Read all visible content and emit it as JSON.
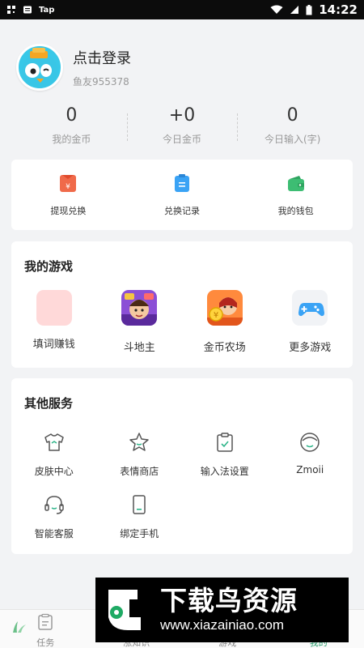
{
  "status_bar": {
    "app_label": "Tap",
    "time": "14:22"
  },
  "profile": {
    "login_text": "点击登录",
    "user_id": "鱼友955378"
  },
  "stats": [
    {
      "value": "0",
      "label": "我的金币"
    },
    {
      "value": "+0",
      "label": "今日金币"
    },
    {
      "value": "0",
      "label": "今日输入(字)"
    }
  ],
  "wallet": [
    {
      "label": "提现兑换",
      "icon": "withdraw-icon",
      "color": "#f06a4a"
    },
    {
      "label": "兑换记录",
      "icon": "record-icon",
      "color": "#3aa3f5"
    },
    {
      "label": "我的钱包",
      "icon": "wallet-icon",
      "color": "#3dbd73"
    }
  ],
  "games": {
    "title": "我的游戏",
    "items": [
      {
        "label": "填词赚钱",
        "icon": "fill-words-icon"
      },
      {
        "label": "斗地主",
        "icon": "doudizhu-icon"
      },
      {
        "label": "金币农场",
        "icon": "coin-farm-icon"
      },
      {
        "label": "更多游戏",
        "icon": "gamepad-icon"
      }
    ]
  },
  "services": {
    "title": "其他服务",
    "items": [
      {
        "label": "皮肤中心",
        "icon": "tshirt-icon"
      },
      {
        "label": "表情商店",
        "icon": "star-icon"
      },
      {
        "label": "输入法设置",
        "icon": "clipboard-check-icon"
      },
      {
        "label": "Zmoii",
        "icon": "face-icon"
      },
      {
        "label": "智能客服",
        "icon": "headset-icon"
      },
      {
        "label": "绑定手机",
        "icon": "phone-icon"
      }
    ]
  },
  "bottom_nav": [
    {
      "label": "任务",
      "icon": "task-icon"
    },
    {
      "label": "涨知识",
      "icon": "knowledge-icon"
    },
    {
      "label": "游戏",
      "icon": "game-icon"
    },
    {
      "label": "我的",
      "icon": "me-icon"
    }
  ],
  "watermark": {
    "title": "下载鸟资源",
    "url": "www.xiazainiao.com"
  },
  "colors": {
    "background": "#f2f3f5",
    "card": "#ffffff",
    "active_tab": "#2a9d6c"
  }
}
